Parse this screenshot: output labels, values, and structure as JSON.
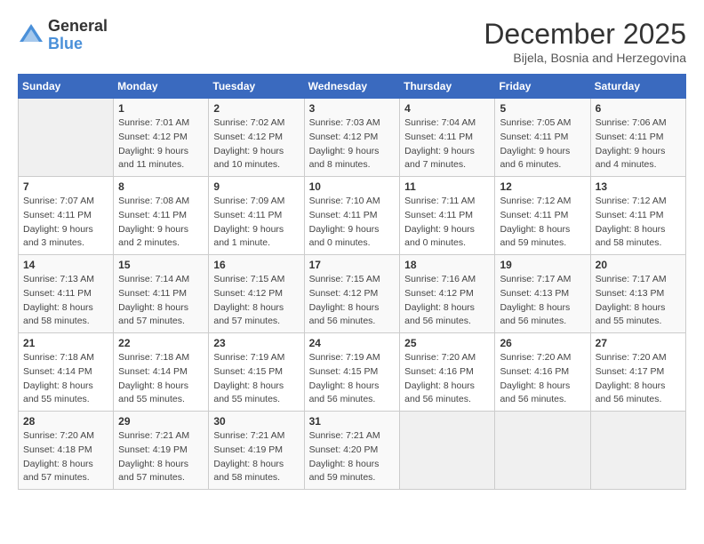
{
  "logo": {
    "general": "General",
    "blue": "Blue"
  },
  "header": {
    "month": "December 2025",
    "location": "Bijela, Bosnia and Herzegovina"
  },
  "days_of_week": [
    "Sunday",
    "Monday",
    "Tuesday",
    "Wednesday",
    "Thursday",
    "Friday",
    "Saturday"
  ],
  "weeks": [
    [
      {
        "day": "",
        "sunrise": "",
        "sunset": "",
        "daylight": ""
      },
      {
        "day": "1",
        "sunrise": "Sunrise: 7:01 AM",
        "sunset": "Sunset: 4:12 PM",
        "daylight": "Daylight: 9 hours and 11 minutes."
      },
      {
        "day": "2",
        "sunrise": "Sunrise: 7:02 AM",
        "sunset": "Sunset: 4:12 PM",
        "daylight": "Daylight: 9 hours and 10 minutes."
      },
      {
        "day": "3",
        "sunrise": "Sunrise: 7:03 AM",
        "sunset": "Sunset: 4:12 PM",
        "daylight": "Daylight: 9 hours and 8 minutes."
      },
      {
        "day": "4",
        "sunrise": "Sunrise: 7:04 AM",
        "sunset": "Sunset: 4:11 PM",
        "daylight": "Daylight: 9 hours and 7 minutes."
      },
      {
        "day": "5",
        "sunrise": "Sunrise: 7:05 AM",
        "sunset": "Sunset: 4:11 PM",
        "daylight": "Daylight: 9 hours and 6 minutes."
      },
      {
        "day": "6",
        "sunrise": "Sunrise: 7:06 AM",
        "sunset": "Sunset: 4:11 PM",
        "daylight": "Daylight: 9 hours and 4 minutes."
      }
    ],
    [
      {
        "day": "7",
        "sunrise": "Sunrise: 7:07 AM",
        "sunset": "Sunset: 4:11 PM",
        "daylight": "Daylight: 9 hours and 3 minutes."
      },
      {
        "day": "8",
        "sunrise": "Sunrise: 7:08 AM",
        "sunset": "Sunset: 4:11 PM",
        "daylight": "Daylight: 9 hours and 2 minutes."
      },
      {
        "day": "9",
        "sunrise": "Sunrise: 7:09 AM",
        "sunset": "Sunset: 4:11 PM",
        "daylight": "Daylight: 9 hours and 1 minute."
      },
      {
        "day": "10",
        "sunrise": "Sunrise: 7:10 AM",
        "sunset": "Sunset: 4:11 PM",
        "daylight": "Daylight: 9 hours and 0 minutes."
      },
      {
        "day": "11",
        "sunrise": "Sunrise: 7:11 AM",
        "sunset": "Sunset: 4:11 PM",
        "daylight": "Daylight: 9 hours and 0 minutes."
      },
      {
        "day": "12",
        "sunrise": "Sunrise: 7:12 AM",
        "sunset": "Sunset: 4:11 PM",
        "daylight": "Daylight: 8 hours and 59 minutes."
      },
      {
        "day": "13",
        "sunrise": "Sunrise: 7:12 AM",
        "sunset": "Sunset: 4:11 PM",
        "daylight": "Daylight: 8 hours and 58 minutes."
      }
    ],
    [
      {
        "day": "14",
        "sunrise": "Sunrise: 7:13 AM",
        "sunset": "Sunset: 4:11 PM",
        "daylight": "Daylight: 8 hours and 58 minutes."
      },
      {
        "day": "15",
        "sunrise": "Sunrise: 7:14 AM",
        "sunset": "Sunset: 4:11 PM",
        "daylight": "Daylight: 8 hours and 57 minutes."
      },
      {
        "day": "16",
        "sunrise": "Sunrise: 7:15 AM",
        "sunset": "Sunset: 4:12 PM",
        "daylight": "Daylight: 8 hours and 57 minutes."
      },
      {
        "day": "17",
        "sunrise": "Sunrise: 7:15 AM",
        "sunset": "Sunset: 4:12 PM",
        "daylight": "Daylight: 8 hours and 56 minutes."
      },
      {
        "day": "18",
        "sunrise": "Sunrise: 7:16 AM",
        "sunset": "Sunset: 4:12 PM",
        "daylight": "Daylight: 8 hours and 56 minutes."
      },
      {
        "day": "19",
        "sunrise": "Sunrise: 7:17 AM",
        "sunset": "Sunset: 4:13 PM",
        "daylight": "Daylight: 8 hours and 56 minutes."
      },
      {
        "day": "20",
        "sunrise": "Sunrise: 7:17 AM",
        "sunset": "Sunset: 4:13 PM",
        "daylight": "Daylight: 8 hours and 55 minutes."
      }
    ],
    [
      {
        "day": "21",
        "sunrise": "Sunrise: 7:18 AM",
        "sunset": "Sunset: 4:14 PM",
        "daylight": "Daylight: 8 hours and 55 minutes."
      },
      {
        "day": "22",
        "sunrise": "Sunrise: 7:18 AM",
        "sunset": "Sunset: 4:14 PM",
        "daylight": "Daylight: 8 hours and 55 minutes."
      },
      {
        "day": "23",
        "sunrise": "Sunrise: 7:19 AM",
        "sunset": "Sunset: 4:15 PM",
        "daylight": "Daylight: 8 hours and 55 minutes."
      },
      {
        "day": "24",
        "sunrise": "Sunrise: 7:19 AM",
        "sunset": "Sunset: 4:15 PM",
        "daylight": "Daylight: 8 hours and 56 minutes."
      },
      {
        "day": "25",
        "sunrise": "Sunrise: 7:20 AM",
        "sunset": "Sunset: 4:16 PM",
        "daylight": "Daylight: 8 hours and 56 minutes."
      },
      {
        "day": "26",
        "sunrise": "Sunrise: 7:20 AM",
        "sunset": "Sunset: 4:16 PM",
        "daylight": "Daylight: 8 hours and 56 minutes."
      },
      {
        "day": "27",
        "sunrise": "Sunrise: 7:20 AM",
        "sunset": "Sunset: 4:17 PM",
        "daylight": "Daylight: 8 hours and 56 minutes."
      }
    ],
    [
      {
        "day": "28",
        "sunrise": "Sunrise: 7:20 AM",
        "sunset": "Sunset: 4:18 PM",
        "daylight": "Daylight: 8 hours and 57 minutes."
      },
      {
        "day": "29",
        "sunrise": "Sunrise: 7:21 AM",
        "sunset": "Sunset: 4:19 PM",
        "daylight": "Daylight: 8 hours and 57 minutes."
      },
      {
        "day": "30",
        "sunrise": "Sunrise: 7:21 AM",
        "sunset": "Sunset: 4:19 PM",
        "daylight": "Daylight: 8 hours and 58 minutes."
      },
      {
        "day": "31",
        "sunrise": "Sunrise: 7:21 AM",
        "sunset": "Sunset: 4:20 PM",
        "daylight": "Daylight: 8 hours and 59 minutes."
      },
      {
        "day": "",
        "sunrise": "",
        "sunset": "",
        "daylight": ""
      },
      {
        "day": "",
        "sunrise": "",
        "sunset": "",
        "daylight": ""
      },
      {
        "day": "",
        "sunrise": "",
        "sunset": "",
        "daylight": ""
      }
    ]
  ]
}
